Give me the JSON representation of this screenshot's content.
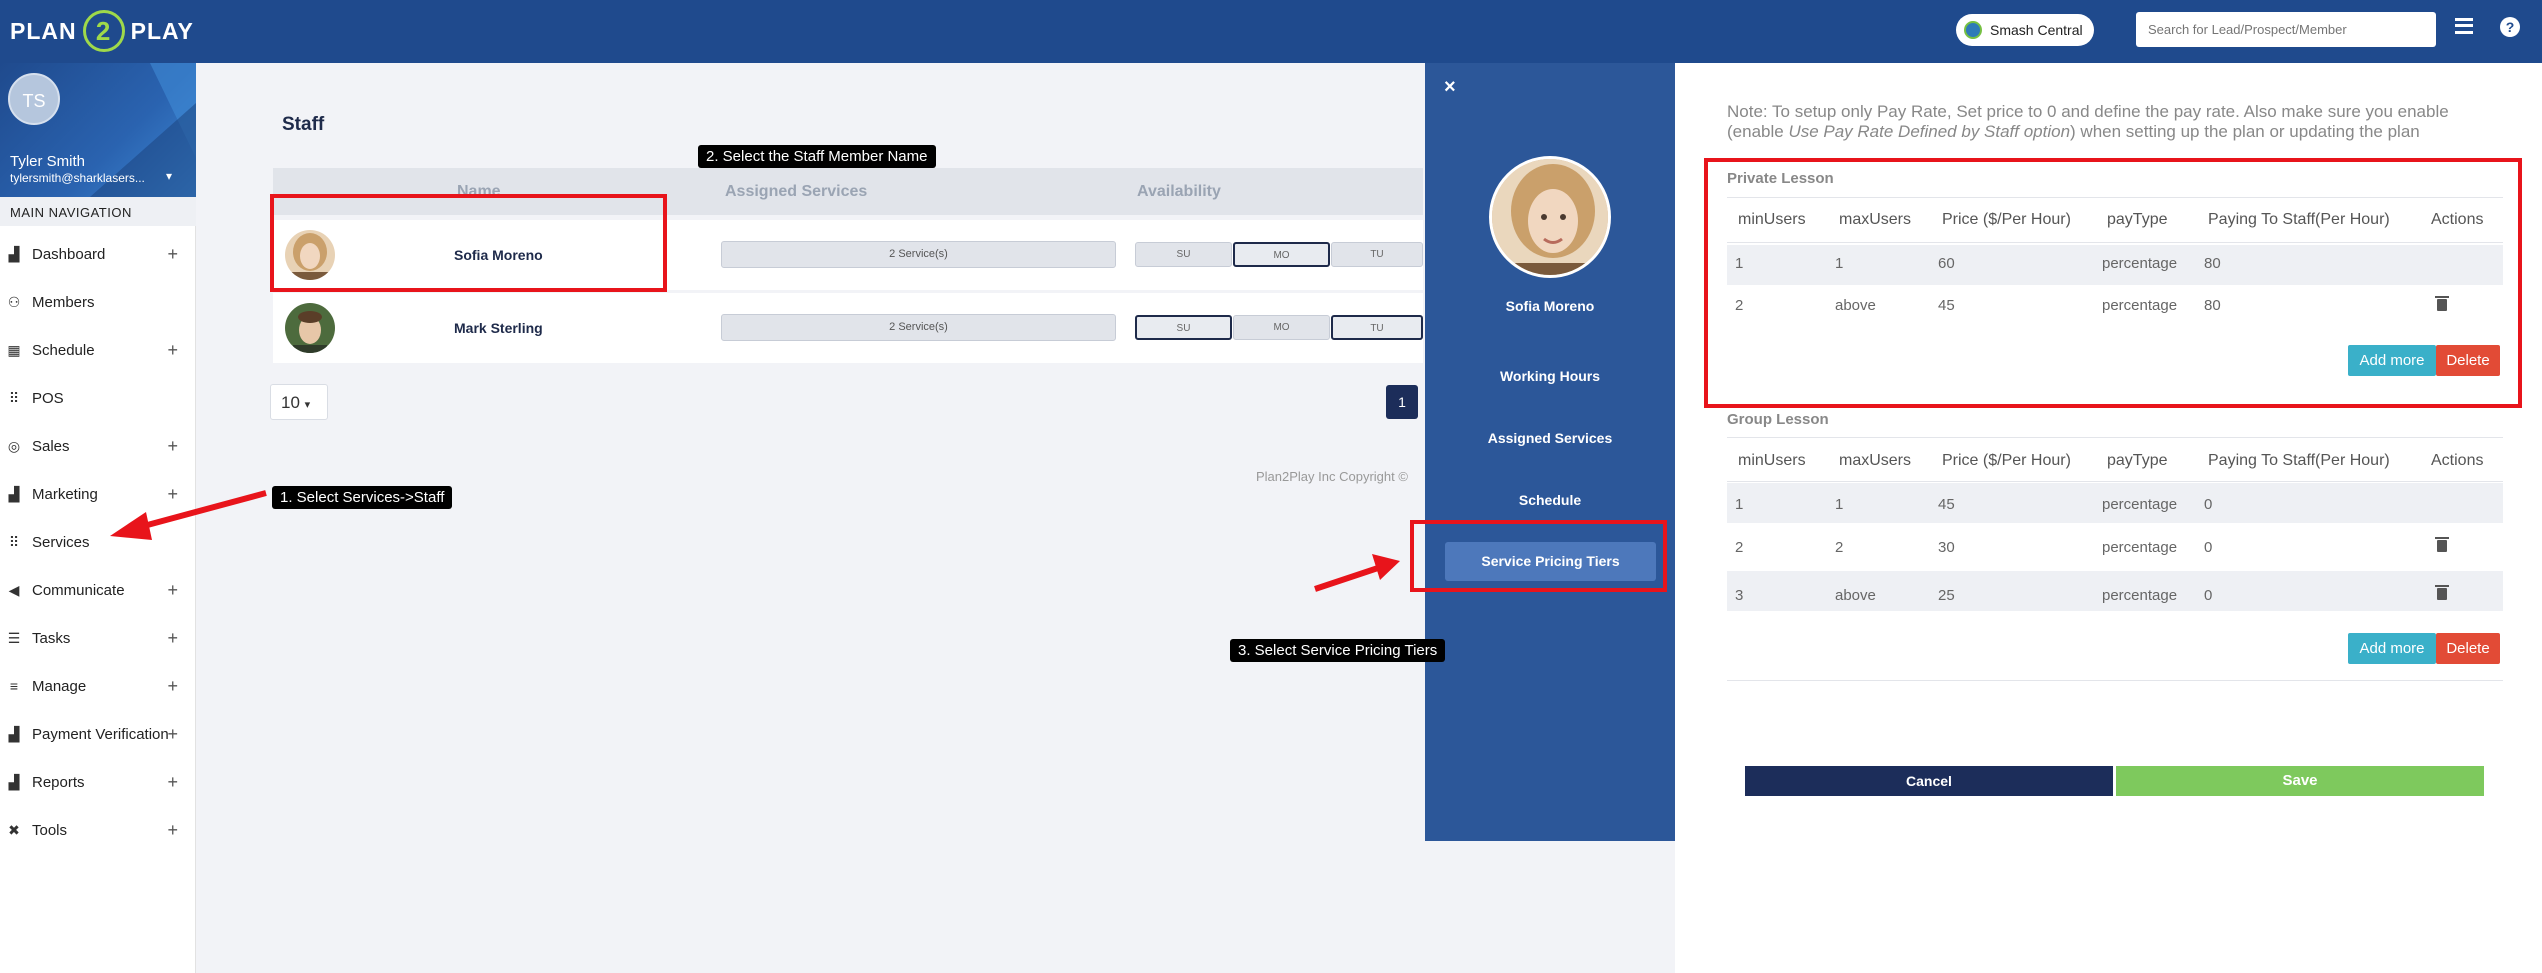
{
  "topbar": {
    "logo_left": "PLAN",
    "logo_mid": "2",
    "logo_right": "PLAY",
    "location": "Smash Central",
    "search_placeholder": "Search for Lead/Prospect/Member",
    "help": "?"
  },
  "sidebar": {
    "initials": "TS",
    "user_name": "Tyler Smith",
    "user_email": "tylersmith@sharklasers...",
    "nav_header": "MAIN NAVIGATION",
    "items": [
      {
        "label": "Dashboard",
        "icon": "chart-icon",
        "expandable": true
      },
      {
        "label": "Members",
        "icon": "users-icon",
        "expandable": false
      },
      {
        "label": "Schedule",
        "icon": "calendar-icon",
        "expandable": true
      },
      {
        "label": "POS",
        "icon": "grid-icon",
        "expandable": false
      },
      {
        "label": "Sales",
        "icon": "target-icon",
        "expandable": true
      },
      {
        "label": "Marketing",
        "icon": "chart-icon",
        "expandable": true
      },
      {
        "label": "Services",
        "icon": "grid-icon",
        "expandable": false
      },
      {
        "label": "Communicate",
        "icon": "megaphone-icon",
        "expandable": true
      },
      {
        "label": "Tasks",
        "icon": "list-icon",
        "expandable": true
      },
      {
        "label": "Manage",
        "icon": "bars-icon",
        "expandable": true
      },
      {
        "label": "Payment Verification",
        "icon": "chart-icon",
        "expandable": true
      },
      {
        "label": "Reports",
        "icon": "chart-icon",
        "expandable": true
      },
      {
        "label": "Tools",
        "icon": "tools-icon",
        "expandable": true
      }
    ]
  },
  "main": {
    "title": "Staff",
    "columns": [
      "Name",
      "Assigned Services",
      "Availability"
    ],
    "rows": [
      {
        "name": "Sofia Moreno",
        "services": "2 Service(s)",
        "days": [
          "SU",
          "MO",
          "TU"
        ],
        "active": [
          false,
          true,
          false
        ]
      },
      {
        "name": "Mark Sterling",
        "services": "2 Service(s)",
        "days": [
          "SU",
          "MO",
          "TU"
        ],
        "active": [
          true,
          false,
          true
        ]
      }
    ],
    "per_page": "10",
    "page": "1",
    "copyright": "Plan2Play Inc Copyright ©"
  },
  "drawer": {
    "close": "×",
    "staff_name": "Sofia Moreno",
    "menu": [
      "Working Hours",
      "Assigned Services",
      "Schedule",
      "Service Pricing Tiers"
    ]
  },
  "pricing": {
    "note_line1": "Note: To setup only Pay Rate, Set price to 0 and define the pay rate. Also make sure you enable",
    "note_line2_pre": "(enable ",
    "note_line2_em": "Use Pay Rate Defined by Staff option",
    "note_line2_post": ") when setting up the plan or updating the plan",
    "columns": [
      "minUsers",
      "maxUsers",
      "Price ($/Per Hour)",
      "payType",
      "Paying To Staff(Per Hour)",
      "Actions"
    ],
    "private": {
      "title": "Private Lesson",
      "rows": [
        [
          "1",
          "1",
          "60",
          "percentage",
          "80"
        ],
        [
          "2",
          "above",
          "45",
          "percentage",
          "80"
        ]
      ]
    },
    "group": {
      "title": "Group Lesson",
      "rows": [
        [
          "1",
          "1",
          "45",
          "percentage",
          "0"
        ],
        [
          "2",
          "2",
          "30",
          "percentage",
          "0"
        ],
        [
          "3",
          "above",
          "25",
          "percentage",
          "0"
        ]
      ]
    },
    "add_more": "Add more",
    "delete": "Delete",
    "cancel": "Cancel",
    "save": "Save"
  },
  "annotations": {
    "step1": "1. Select Services->Staff",
    "step2": "2. Select the Staff Member Name",
    "step3": "3. Select Service Pricing Tiers",
    "highlight_color": "#e8141b"
  }
}
